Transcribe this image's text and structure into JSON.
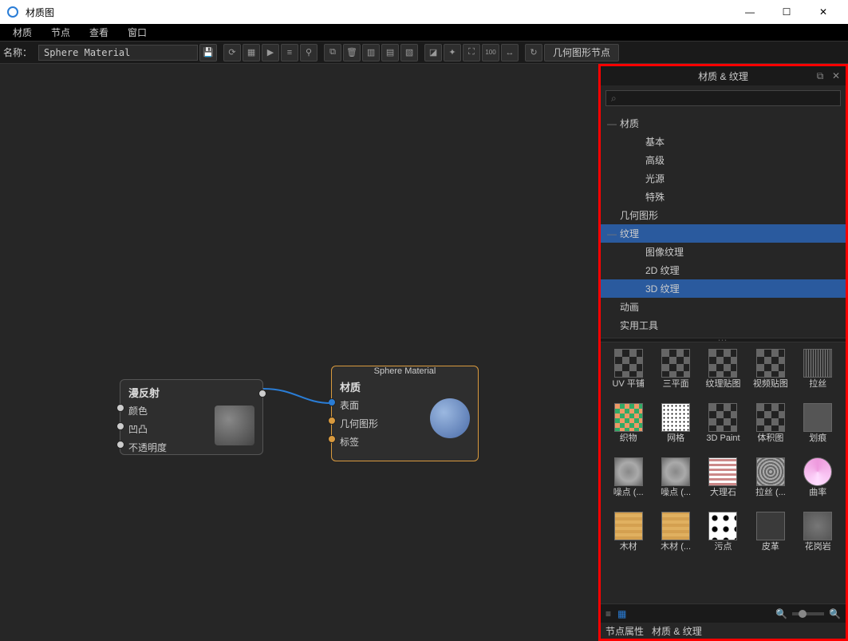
{
  "window": {
    "title": "材质图"
  },
  "menu": {
    "items": [
      "材质",
      "节点",
      "查看",
      "窗口"
    ]
  },
  "toolbar": {
    "name_label": "名称：",
    "name_value": "Sphere Material",
    "geom_label": "几何图形节点"
  },
  "nodes": {
    "diffuse": {
      "header": "漫反射",
      "rows": [
        "颜色",
        "凹凸",
        "不透明度"
      ]
    },
    "material": {
      "title": "Sphere Material",
      "header": "材质",
      "rows": [
        "表面",
        "几何图形",
        "标签"
      ]
    }
  },
  "panel": {
    "title": "材质 & 纹理",
    "search_placeholder": "",
    "tree": [
      {
        "label": "材质",
        "expand": "—"
      },
      {
        "label": "基本",
        "indent": 1
      },
      {
        "label": "高级",
        "indent": 1
      },
      {
        "label": "光源",
        "indent": 1
      },
      {
        "label": "特殊",
        "indent": 1
      },
      {
        "label": "几何图形"
      },
      {
        "label": "纹理",
        "expand": "—",
        "selected": true
      },
      {
        "label": "图像纹理",
        "indent": 1
      },
      {
        "label": "2D 纹理",
        "indent": 1
      },
      {
        "label": "3D 纹理",
        "indent": 1,
        "selected": true
      },
      {
        "label": "动画"
      },
      {
        "label": "实用工具"
      }
    ],
    "thumbs": [
      {
        "label": "UV 平铺",
        "cls": "checker"
      },
      {
        "label": "三平面",
        "cls": "checker"
      },
      {
        "label": "纹理贴图",
        "cls": "checker"
      },
      {
        "label": "视频贴图",
        "cls": "checker"
      },
      {
        "label": "拉丝",
        "cls": "lines"
      },
      {
        "label": "织物",
        "cls": "green"
      },
      {
        "label": "网格",
        "cls": "dots"
      },
      {
        "label": "3D Paint",
        "cls": "checker"
      },
      {
        "label": "体积图",
        "cls": "checker"
      },
      {
        "label": "划痕",
        "cls": "scratch"
      },
      {
        "label": "噪点 (...",
        "cls": "noise"
      },
      {
        "label": "噪点 (...",
        "cls": "noise"
      },
      {
        "label": "大理石",
        "cls": "stripes"
      },
      {
        "label": "拉丝 (...",
        "cls": "circ"
      },
      {
        "label": "曲率",
        "cls": "swirl"
      },
      {
        "label": "木材",
        "cls": "wood"
      },
      {
        "label": "木材 (...",
        "cls": "wood"
      },
      {
        "label": "污点",
        "cls": "spots"
      },
      {
        "label": "皮革",
        "cls": "leather"
      },
      {
        "label": "花岗岩",
        "cls": "granite"
      }
    ]
  },
  "tabs": {
    "items": [
      "节点属性",
      "材质 & 纹理"
    ]
  }
}
